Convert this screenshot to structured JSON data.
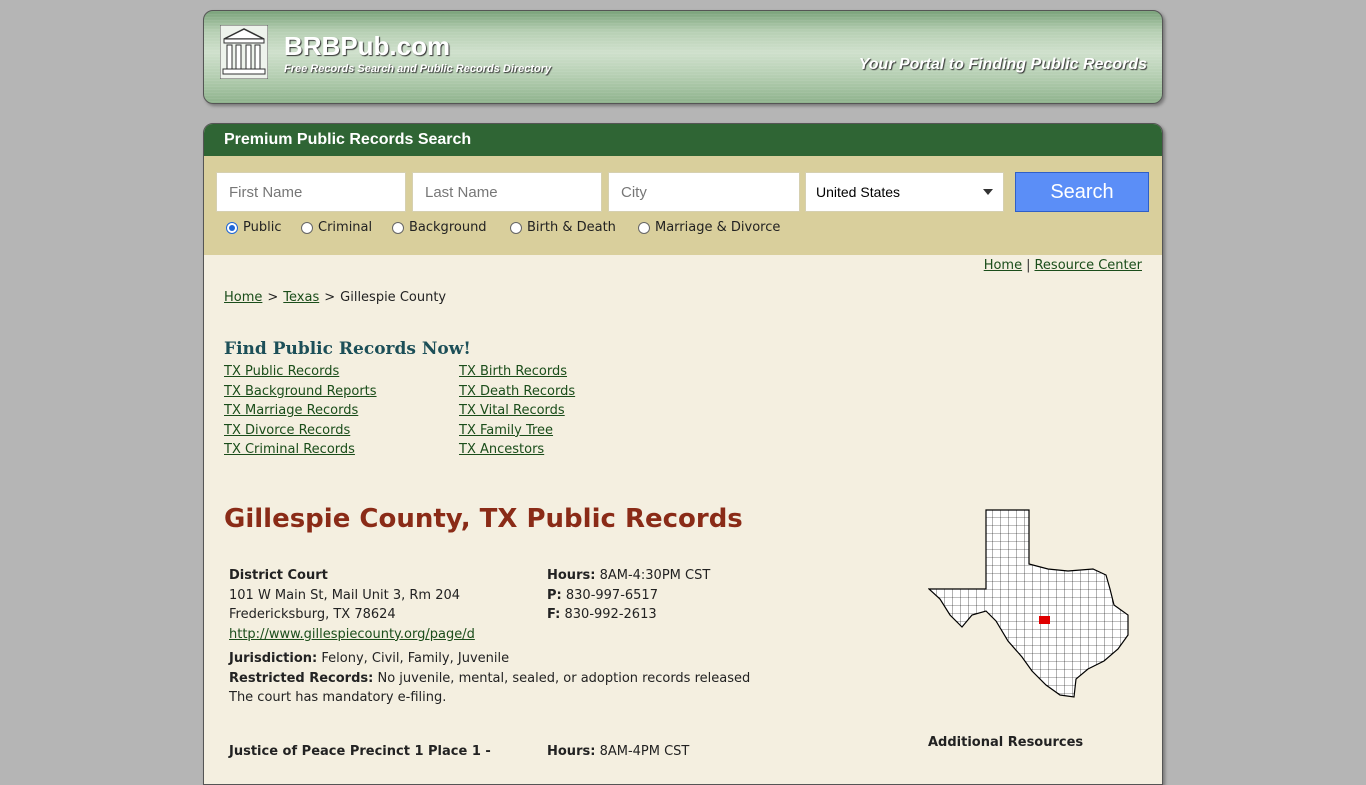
{
  "header": {
    "brand": "BRBPub.com",
    "tagline": "Free Records Search and Public Records Directory",
    "portal": "Your Portal to Finding Public Records"
  },
  "search": {
    "title": "Premium Public Records Search",
    "first_name_placeholder": "First Name",
    "last_name_placeholder": "Last Name",
    "city_placeholder": "City",
    "country_selected": "United States",
    "button_label": "Search",
    "radios": [
      {
        "label": "Public",
        "checked": true
      },
      {
        "label": "Criminal",
        "checked": false
      },
      {
        "label": "Background",
        "checked": false
      },
      {
        "label": "Birth & Death",
        "checked": false
      },
      {
        "label": "Marriage & Divorce",
        "checked": false
      }
    ]
  },
  "toplinks": {
    "home": "Home",
    "separator": "|",
    "resource_center": "Resource Center"
  },
  "breadcrumb": {
    "home": "Home",
    "state": "Texas",
    "current": "Gillespie County",
    "sep": ">"
  },
  "find": {
    "title": "Find Public Records Now!",
    "col1": [
      "TX Public Records",
      "TX Background Reports",
      "TX Marriage Records",
      "TX Divorce Records",
      "TX Criminal Records"
    ],
    "col2": [
      "TX Birth Records",
      "TX Death Records",
      "TX Vital Records",
      "TX Family Tree",
      "TX Ancestors"
    ]
  },
  "county_title": "Gillespie County, TX Public Records",
  "district_court": {
    "name": "District Court",
    "address1": "101 W Main St, Mail Unit 3, Rm 204",
    "address2": "Fredericksburg, TX 78624",
    "url": "http://www.gillespiecounty.org/page/d",
    "hours_label": "Hours:",
    "hours": "8AM-4:30PM CST",
    "phone_label": "P:",
    "phone": "830-997-6517",
    "fax_label": "F:",
    "fax": "830-992-2613",
    "jurisdiction_label": "Jurisdiction:",
    "jurisdiction": "Felony, Civil, Family, Juvenile",
    "restricted_label": "Restricted Records:",
    "restricted": "No juvenile, mental, sealed, or adoption records released",
    "note": "The court has mandatory e-filing."
  },
  "jp_court": {
    "name": "Justice of Peace Precinct 1 Place 1 -",
    "hours_label": "Hours:",
    "hours": "8AM-4PM CST"
  },
  "sidebar": {
    "additional_resources": "Additional Resources"
  },
  "colors": {
    "header_green": "#2f6534",
    "search_bg": "#d9cf9c",
    "panel_bg": "#f4efe0",
    "title_red": "#8a2b17",
    "button_blue": "#5b8ef7"
  }
}
